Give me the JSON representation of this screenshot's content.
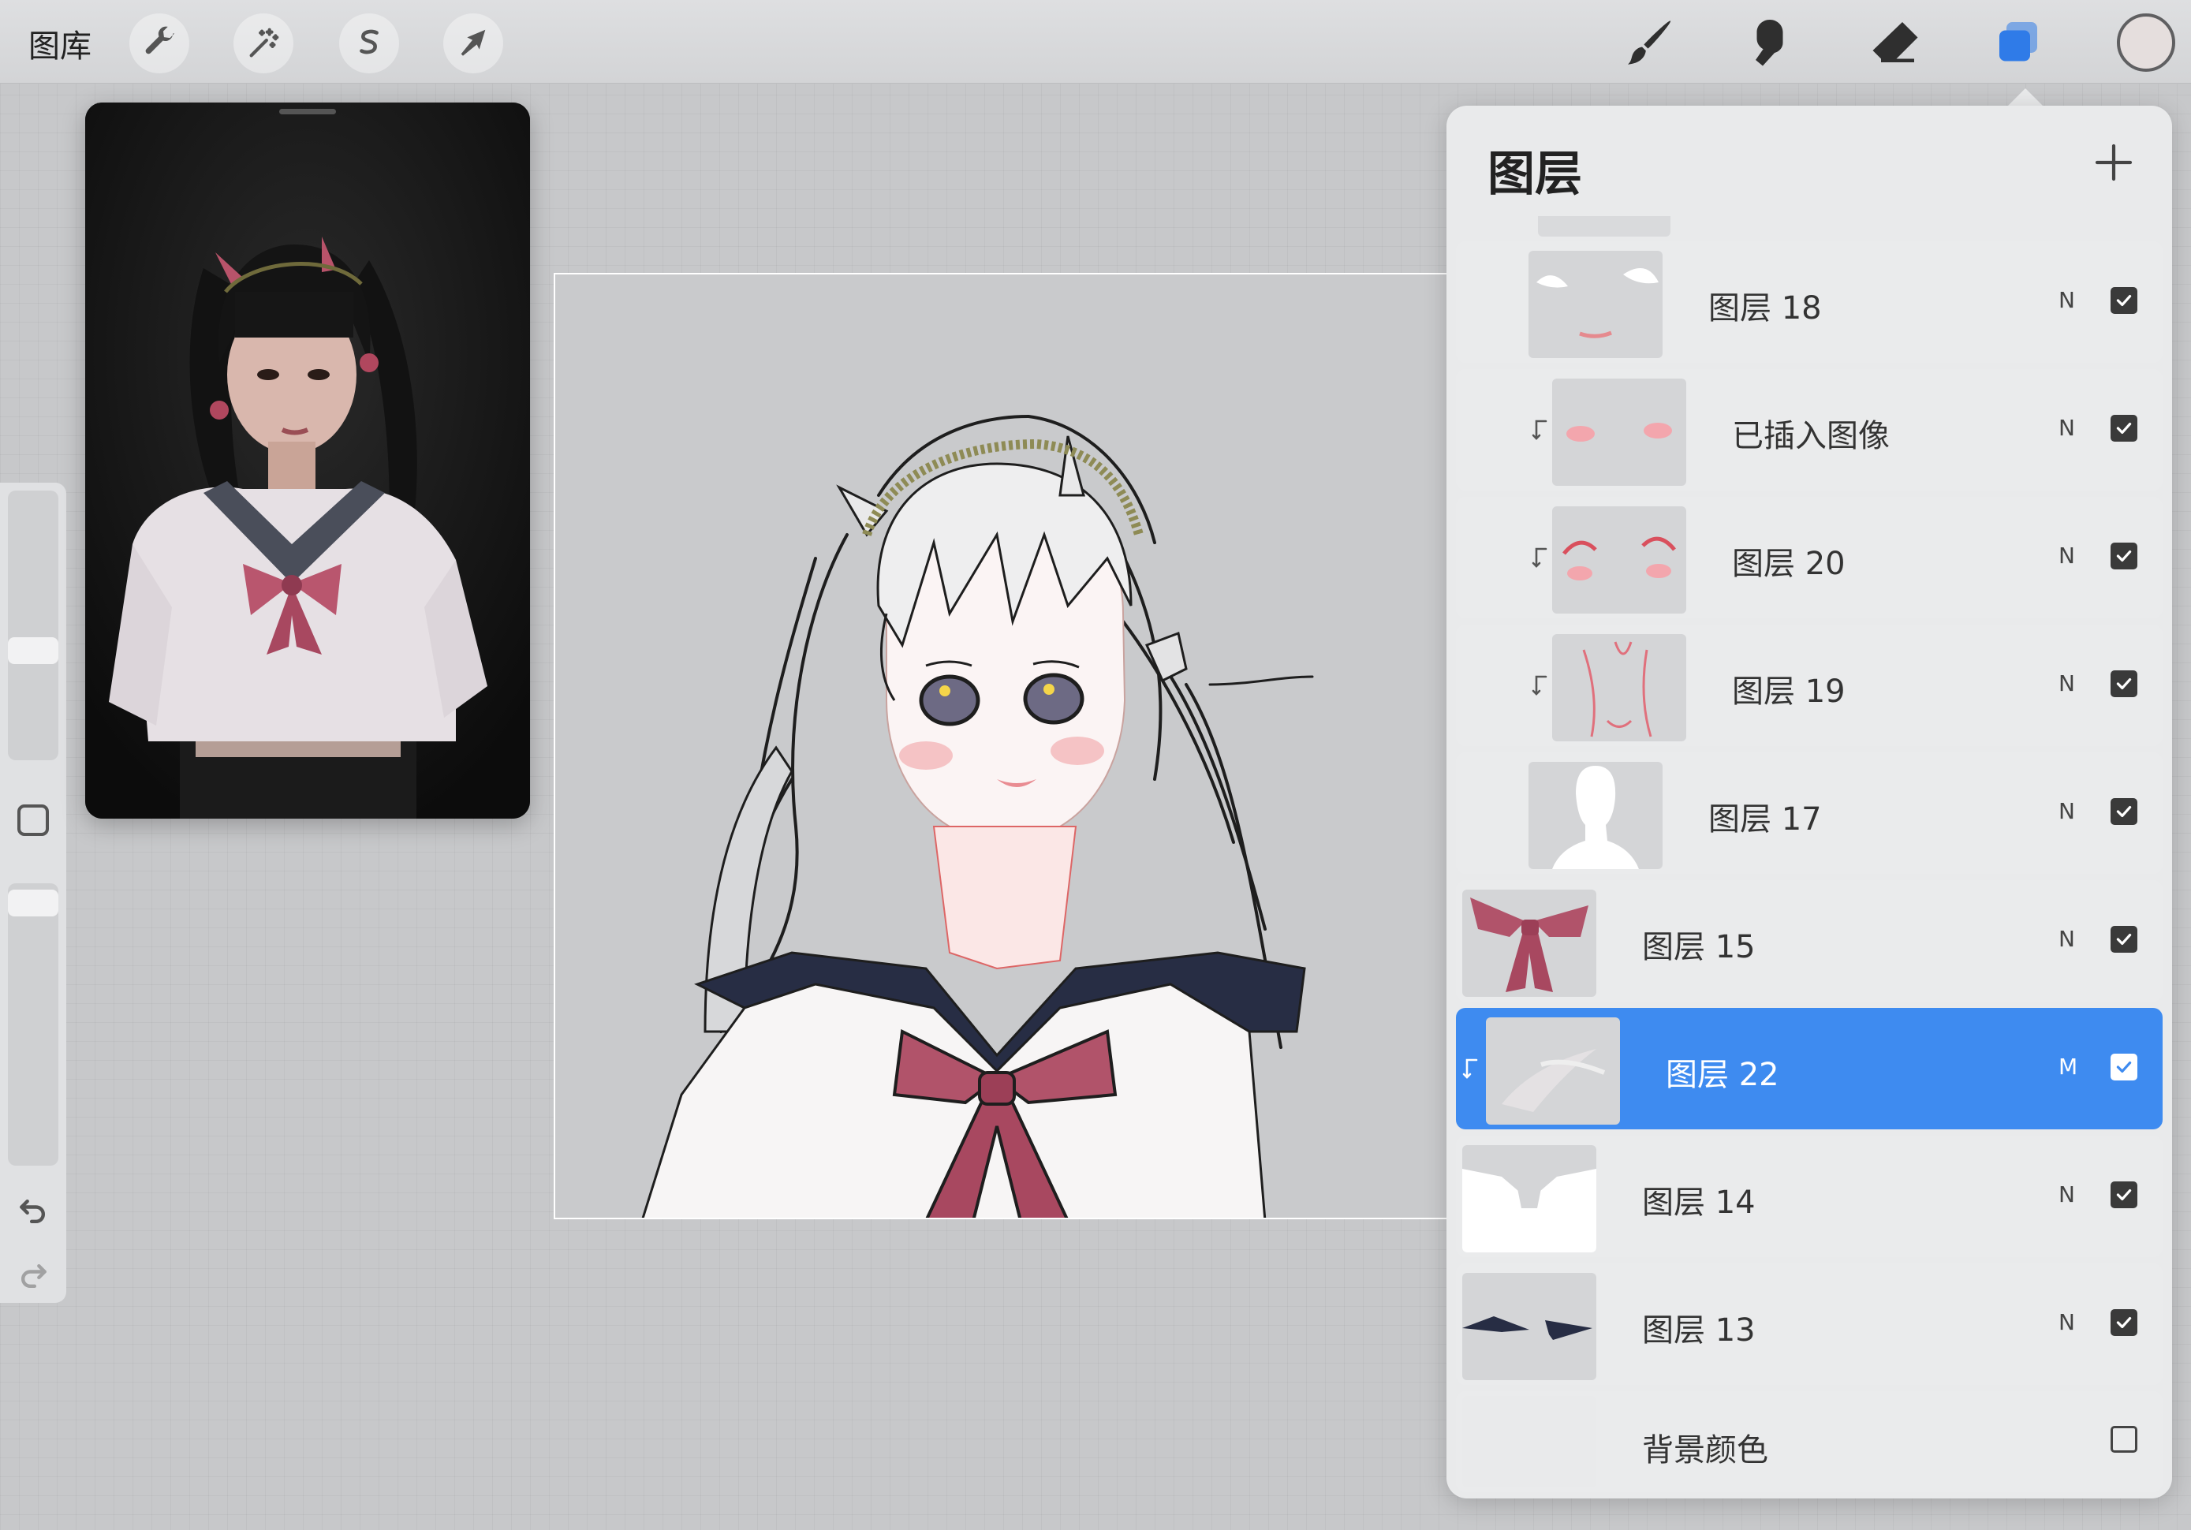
{
  "toolbar": {
    "gallery_label": "图库",
    "tools_left": [
      {
        "name": "actions",
        "icon": "wrench-icon"
      },
      {
        "name": "adjustments",
        "icon": "magic-wand-icon"
      },
      {
        "name": "selection",
        "icon": "selection-icon"
      },
      {
        "name": "transform",
        "icon": "transform-arrow-icon"
      }
    ],
    "tools_right": [
      {
        "name": "brush",
        "icon": "brush-icon"
      },
      {
        "name": "smudge",
        "icon": "smudge-icon"
      },
      {
        "name": "eraser",
        "icon": "eraser-icon"
      },
      {
        "name": "layers",
        "icon": "layers-icon",
        "active": true,
        "color": "#2f7be8"
      }
    ],
    "current_color": "#e5dedd"
  },
  "sidebar": {
    "modifier": "square-modifier-icon",
    "undo": "undo-icon",
    "redo": "redo-icon"
  },
  "layers_panel": {
    "title": "图层",
    "add_button": "+",
    "accent_color": "#3e8bf0",
    "layers": [
      {
        "name": "图层 18",
        "blend": "N",
        "visible": true,
        "clipped": false,
        "active": false
      },
      {
        "name": "已插入图像",
        "blend": "N",
        "visible": true,
        "clipped": true,
        "active": false
      },
      {
        "name": "图层 20",
        "blend": "N",
        "visible": true,
        "clipped": true,
        "active": false
      },
      {
        "name": "图层 19",
        "blend": "N",
        "visible": true,
        "clipped": true,
        "active": false
      },
      {
        "name": "图层 17",
        "blend": "N",
        "visible": true,
        "clipped": false,
        "active": false
      },
      {
        "name": "图层 15",
        "blend": "N",
        "visible": true,
        "clipped": false,
        "active": false
      },
      {
        "name": "图层 22",
        "blend": "M",
        "visible": true,
        "clipped": true,
        "active": true
      },
      {
        "name": "图层 14",
        "blend": "N",
        "visible": true,
        "clipped": false,
        "active": false
      },
      {
        "name": "图层 13",
        "blend": "N",
        "visible": true,
        "clipped": false,
        "active": false
      }
    ],
    "background": {
      "name": "背景颜色",
      "visible": false
    }
  }
}
